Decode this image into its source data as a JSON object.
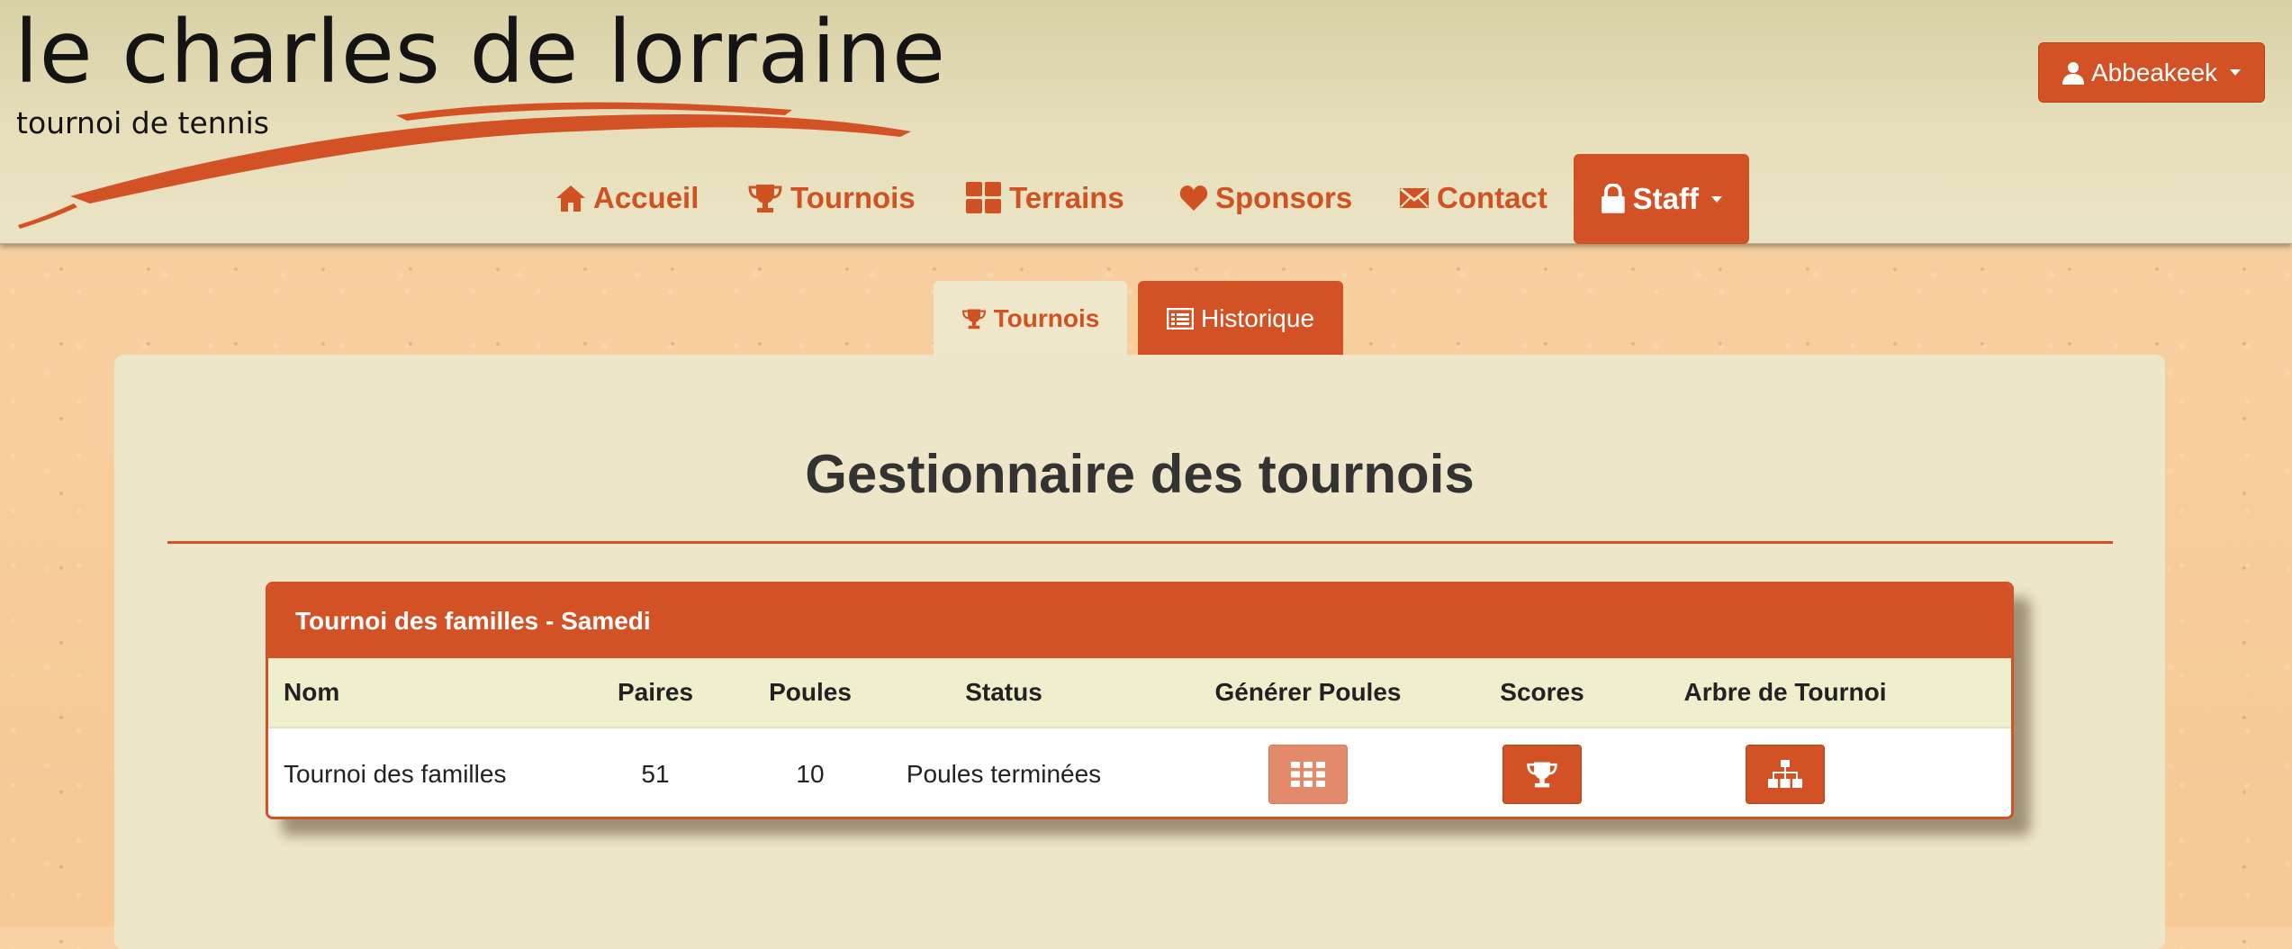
{
  "logo": {
    "title": "le charles de lorraine",
    "subtitle": "tournoi de tennis"
  },
  "user_menu": {
    "label": "Abbeakeek",
    "icon": "user-icon"
  },
  "nav": {
    "items": [
      {
        "label": "Accueil",
        "icon": "home-icon"
      },
      {
        "label": "Tournois",
        "icon": "trophy-icon"
      },
      {
        "label": "Terrains",
        "icon": "grid-icon"
      },
      {
        "label": "Sponsors",
        "icon": "heart-icon"
      },
      {
        "label": "Contact",
        "icon": "envelope-icon"
      },
      {
        "label": "Staff",
        "icon": "lock-icon",
        "active": true
      }
    ]
  },
  "tabs": [
    {
      "label": "Tournois",
      "icon": "trophy-icon",
      "active": true
    },
    {
      "label": "Historique",
      "icon": "list-icon"
    }
  ],
  "main": {
    "title": "Gestionnaire des tournois"
  },
  "tournament": {
    "heading": "Tournoi des familles - Samedi",
    "columns": [
      "Nom",
      "Paires",
      "Poules",
      "Status",
      "Générer Poules",
      "Scores",
      "Arbre de Tournoi"
    ],
    "row": {
      "nom": "Tournoi des familles",
      "paires": "51",
      "poules": "10",
      "status": "Poules terminées",
      "generate_icon": "grid-icon",
      "scores_icon": "trophy-icon",
      "tree_icon": "sitemap-icon"
    }
  },
  "colors": {
    "accent": "#d35225",
    "header_bg": "#e7dfbb",
    "panel_bg": "#eee6c8",
    "page_bg": "#f7cf9f"
  }
}
